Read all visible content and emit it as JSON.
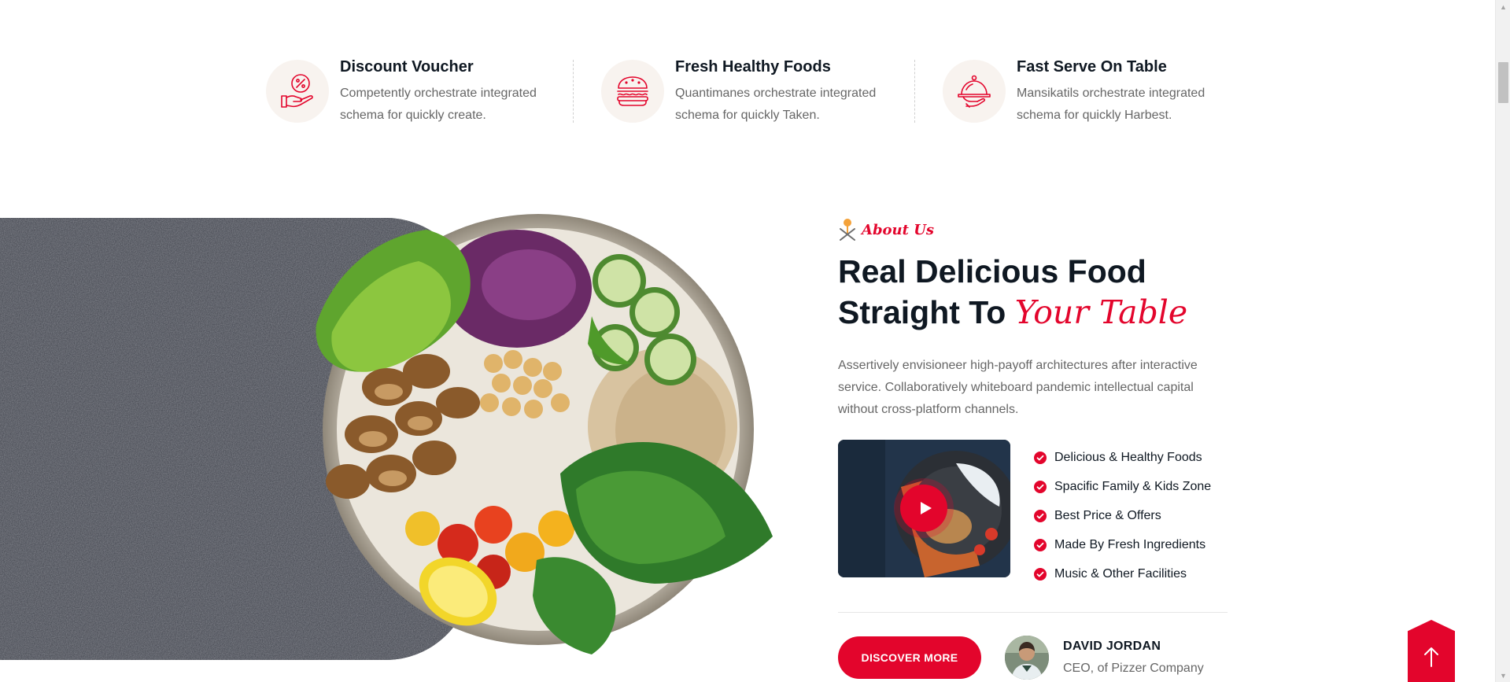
{
  "features": [
    {
      "title": "Discount Voucher",
      "desc": "Competently orchestrate integrated schema for quickly create.",
      "icon": "discount-hand-icon"
    },
    {
      "title": "Fresh Healthy Foods",
      "desc": "Quantimanes orchestrate integrated schema for quickly Taken.",
      "icon": "burger-icon"
    },
    {
      "title": "Fast Serve On Table",
      "desc": "Mansikatils orchestrate integrated schema for quickly Harbest.",
      "icon": "cloche-icon"
    }
  ],
  "about": {
    "subtitle": "About Us",
    "heading_line1": "Real Delicious Food",
    "heading_line2": "Straight To ",
    "heading_accent": "Your Table",
    "description": "Assertively envisioneer high-payoff architectures after interactive service. Collaboratively whiteboard pandemic intellectual capital without cross-platform channels.",
    "checklist": [
      "Delicious & Healthy Foods",
      "Spacific Family & Kids Zone",
      "Best Price & Offers",
      "Made By Fresh Ingredients",
      "Music & Other Facilities"
    ],
    "discover_label": "DISCOVER MORE",
    "author_name": "DAVID JORDAN",
    "author_role": "CEO, of Pizzer Company"
  },
  "colors": {
    "accent": "#e3052c",
    "heading": "#0f1822",
    "body_text": "#666666",
    "icon_bg": "#f8f3ef"
  }
}
